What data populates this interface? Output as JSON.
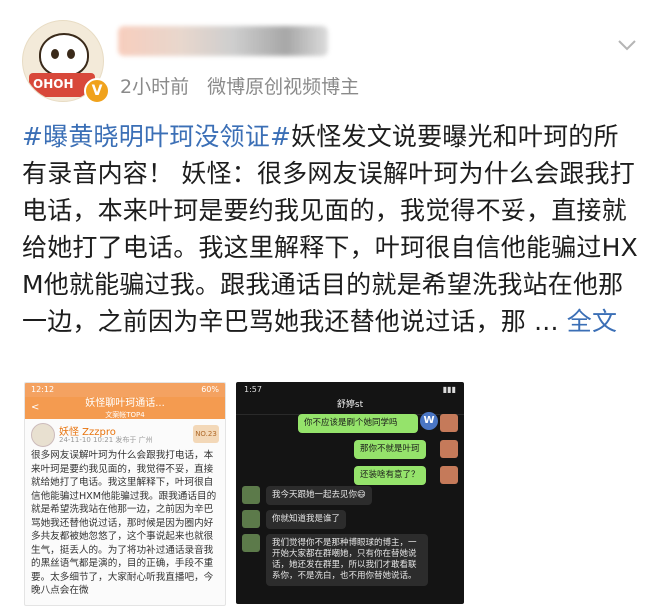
{
  "post": {
    "time": "2小时前",
    "source": "微博原创视频博主",
    "topic": "#曝黄晓明叶珂没领证#",
    "body": "妖怪发文说要曝光和叶珂的所有录音内容！ 妖怪：很多网友误解叶珂为什么会跟我打电话，本来叶珂是要约我见面的，我觉得不妥，直接就给她打了电话。我这里解释下，叶珂很自信他能骗过HXM他就能骗过我。跟我通话目的就是希望洗我站在他那一边，之前因为辛巴骂她我还替他说过话，那 ... ",
    "full_text_link": "全文",
    "verify_badge": "V"
  },
  "avatar": {
    "hat_label": "OHOH"
  },
  "screenshot_left": {
    "status_time": "12:12",
    "status_battery": "60%",
    "nav_title": "妖怪聊叶珂通话...",
    "nav_sub": "文案帐TOP4",
    "back": "<",
    "user_name": "妖怪 Zzzpro",
    "user_date": "24-11-10 10:21  发布于 广州",
    "rank": "NO.23",
    "text": "很多网友误解叶珂为什么会跟我打电话，本来叶珂是要约我见面的，我觉得不妥，直接就给她打了电话。我这里解释下，叶珂很自信他能骗过HXM他能骗过我。跟我通话目的就是希望洗我站在他那一边，之前因为辛巴骂她我还替他说过话，那时候是因为圈内好多共友都被她忽悠了，这个事说起来也就很生气，挺丢人的。为了将功补过通话录音我的黑丝语气都是演的，目的正确，手段不重要。太多细节了，大家耐心听我直播吧，今晚八点会在微"
  },
  "screenshot_right": {
    "status_time": "1:57",
    "chat_title": "舒婷st",
    "w_avatar": "W",
    "messages": [
      {
        "text": "你不应该是刷个她同学吗",
        "side": "out"
      },
      {
        "text": "那你不就是叶珂",
        "side": "out"
      },
      {
        "text": "还装啥有意了？",
        "side": "out"
      },
      {
        "text": "我今天跟她一起去见你😄",
        "side": "in"
      },
      {
        "text": "你就知道我是谁了",
        "side": "in"
      },
      {
        "text": "我们觉得你不是那种博眼球的博主，一开始大家都在群嘲她，只有你在替她说话，她还发在群里，所以我们才敢看联系你，不是冼白，也不用你替她说话。",
        "side": "in"
      }
    ]
  },
  "icons": {
    "more": "chevron-down-icon"
  }
}
